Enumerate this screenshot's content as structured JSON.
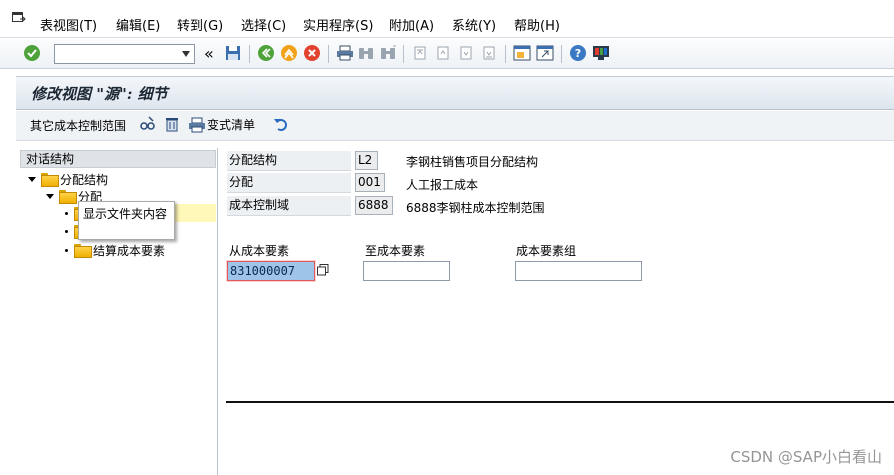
{
  "menubar": {
    "items": [
      {
        "label": "表视图(T)"
      },
      {
        "label": "编辑(E)"
      },
      {
        "label": "转到(G)"
      },
      {
        "label": "选择(C)"
      },
      {
        "label": "实用程序(S)"
      },
      {
        "label": "附加(A)"
      },
      {
        "label": "系统(Y)"
      },
      {
        "label": "帮助(H)"
      }
    ]
  },
  "toolbar": {
    "command_value": "",
    "nav_prev_label": "«",
    "icons": [
      "enter-check-icon",
      "command-dropdown-icon",
      "save-icon",
      "back-icon",
      "exit-icon",
      "cancel-icon",
      "print-icon",
      "find-icon",
      "find-next-icon",
      "first-page-icon",
      "prev-page-icon",
      "next-page-icon",
      "last-page-icon",
      "new-session-icon",
      "shortcut-icon",
      "help-icon",
      "customize-layout-icon"
    ]
  },
  "title": "修改视图 \"源\": 细节",
  "app_toolbar": {
    "other_area_label": "其它成本控制范围",
    "change_log_label": "变式清单",
    "icons": [
      "edit-glasses-icon",
      "delete-trash-icon",
      "print-list-icon",
      "undo-icon"
    ]
  },
  "tree": {
    "header": "对话结构",
    "items": [
      {
        "label": "分配结构",
        "level": 0,
        "expanded": true
      },
      {
        "label": "分配",
        "level": 1,
        "expanded": true
      },
      {
        "label": "",
        "level": 2
      },
      {
        "label": "",
        "level": 2
      },
      {
        "label": "结算成本要素",
        "level": 2
      }
    ],
    "tooltip": "显示文件夹内容"
  },
  "form": {
    "alloc_structure": {
      "label": "分配结构",
      "value": "L2",
      "desc": "李钢柱销售项目分配结构"
    },
    "allocation": {
      "label": "分配",
      "value": "001",
      "desc": "人工报工成本"
    },
    "controlling_area": {
      "label": "成本控制域",
      "value": "6888",
      "desc": "6888李钢柱成本控制范围"
    },
    "from_cost_element": {
      "label": "从成本要素",
      "value": "831000007"
    },
    "to_cost_element": {
      "label": "至成本要素",
      "value": ""
    },
    "cost_element_group": {
      "label": "成本要素组",
      "value": ""
    }
  },
  "watermark": "CSDN @SAP小白看山"
}
